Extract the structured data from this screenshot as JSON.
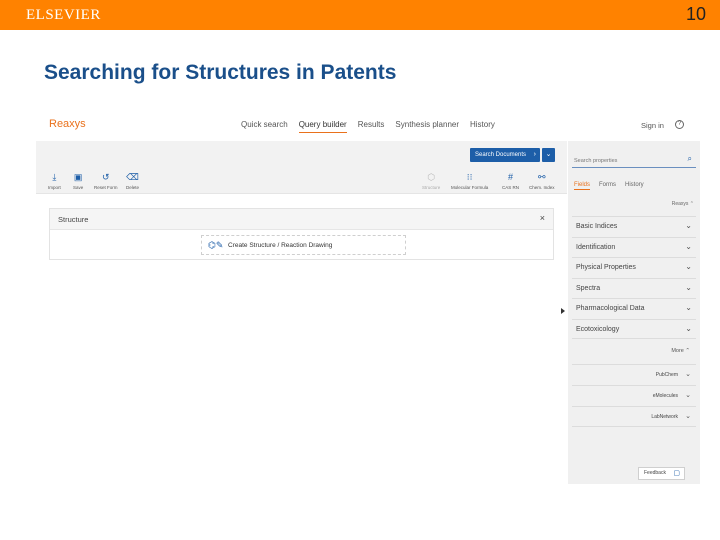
{
  "slide": {
    "brand": "ELSEVIER",
    "page_number": "10",
    "title": "Searching for Structures in Patents",
    "accent_color": "#ff8200",
    "title_color": "#1a4f8a"
  },
  "app": {
    "logo": "Reaxys",
    "nav": [
      {
        "label": "Quick search",
        "active": false
      },
      {
        "label": "Query builder",
        "active": true
      },
      {
        "label": "Results",
        "active": false
      },
      {
        "label": "Synthesis planner",
        "active": false
      },
      {
        "label": "History",
        "active": false
      }
    ],
    "sign_in": "Sign in",
    "help_icon": "help-circle-icon",
    "toolbar": {
      "search_button": "Search Documents",
      "tools_left": [
        {
          "label": "Import",
          "icon": "download-icon",
          "glyph": "⤓"
        },
        {
          "label": "Save",
          "icon": "save-icon",
          "glyph": "▣"
        },
        {
          "label": "Reset Form",
          "icon": "reset-icon",
          "glyph": "↺"
        },
        {
          "label": "Delete",
          "icon": "trash-icon",
          "glyph": "🗑"
        }
      ],
      "tools_right": [
        {
          "label": "Structure",
          "icon": "structure-icon",
          "glyph": "⬡",
          "dim": true
        },
        {
          "label": "Molecular Formula",
          "icon": "formula-icon",
          "glyph": "⁝⁝",
          "dim": false
        },
        {
          "label": "CAS RN",
          "icon": "hash-icon",
          "glyph": "#",
          "dim": false
        },
        {
          "label": "Chem. Index",
          "icon": "index-icon",
          "glyph": "⚯",
          "dim": false
        }
      ]
    },
    "structure_panel": {
      "title": "Structure",
      "draw_label": "Create Structure / Reaction Drawing"
    },
    "sidebar": {
      "search_placeholder": "Search properties",
      "tabs": [
        {
          "label": "Fields",
          "active": true
        },
        {
          "label": "Forms",
          "active": false
        },
        {
          "label": "History",
          "active": false
        }
      ],
      "section_toggle": "Reaxys",
      "items": [
        "Basic Indices",
        "Identification",
        "Physical Properties",
        "Spectra",
        "Pharmacological Data",
        "Ecotoxicology"
      ],
      "more_label": "More",
      "external": [
        "PubChem",
        "eMolecules",
        "LabNetwork"
      ],
      "feedback": "Feedback"
    }
  }
}
